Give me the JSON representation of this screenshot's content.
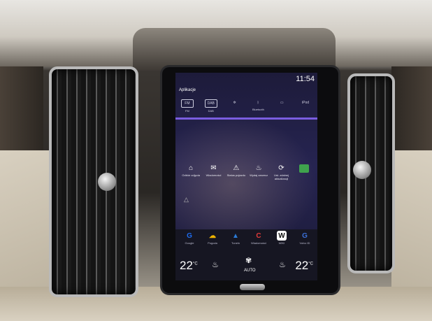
{
  "screen": {
    "clock": "11:54",
    "section_title": "Aplikacje",
    "top_row": [
      {
        "icon": "FM",
        "label": "FM"
      },
      {
        "icon": "DAB",
        "label": "DAB"
      },
      {
        "icon": "✲",
        "label": ""
      },
      {
        "icon": "ᛒ",
        "label": "Bluetooth"
      },
      {
        "icon": "▭",
        "label": ""
      },
      {
        "icon": "iPod",
        "label": ""
      }
    ],
    "middle_row": [
      {
        "icon": "⌂",
        "label": "Odbiór zdjęcia"
      },
      {
        "icon": "✉",
        "label": "Wiadomości"
      },
      {
        "icon": "⚠",
        "label": "Status pojazdu"
      },
      {
        "icon": "♨",
        "label": "Wydaj zarzecz"
      },
      {
        "icon": "⟳",
        "label": "Ust. zdalnej aktualizacji"
      },
      {
        "icon": "",
        "label": ""
      }
    ],
    "apps": [
      {
        "icon": "G",
        "label": "Google",
        "color": "#1e6cf0"
      },
      {
        "icon": "☁",
        "label": "Pogoda",
        "color": "#f0b400"
      },
      {
        "icon": "▲",
        "label": "Tuneln",
        "color": "#2a7bd6"
      },
      {
        "icon": "C",
        "label": "Wiadomości",
        "color": "#e23b3b"
      },
      {
        "icon": "W",
        "label": "WIKI",
        "color": "#ffffff"
      },
      {
        "icon": "G",
        "label": "Volvo ID",
        "color": "#3b6fd6"
      }
    ],
    "climate": {
      "left_temp": "22",
      "right_temp": "22",
      "unit": "°C",
      "mode": "AUTO"
    }
  }
}
